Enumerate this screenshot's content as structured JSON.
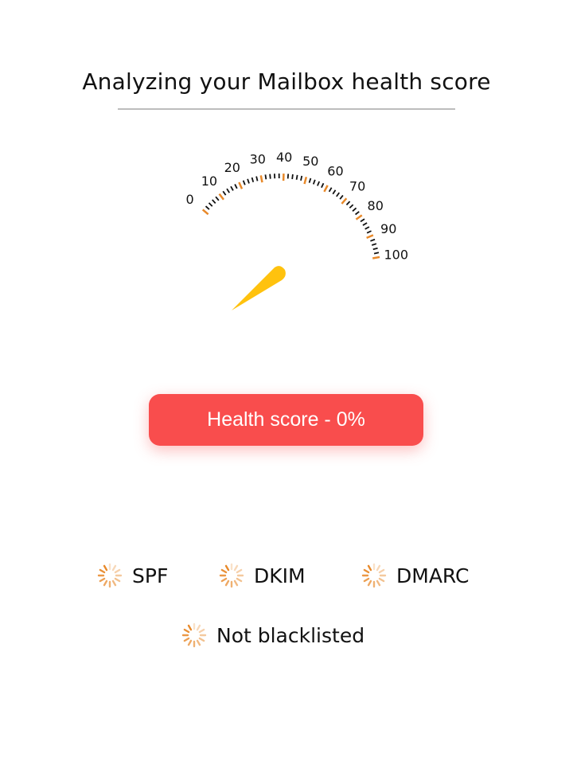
{
  "header": {
    "title": "Analyzing your Mailbox health score"
  },
  "gauge": {
    "min": 0,
    "max": 100,
    "value": 0,
    "tick_labels": [
      "0",
      "10",
      "20",
      "30",
      "40",
      "50",
      "60",
      "70",
      "80",
      "90",
      "100"
    ],
    "major_tick_color": "#e8892a",
    "minor_tick_color": "#111111",
    "needle_color": "#ffc20e"
  },
  "score_button": {
    "label": "Health score - 0%",
    "color": "#f94d4d"
  },
  "checks": {
    "spf": {
      "label": "SPF",
      "icon": "loading-spinner-icon"
    },
    "dkim": {
      "label": "DKIM",
      "icon": "loading-spinner-icon"
    },
    "dmarc": {
      "label": "DMARC",
      "icon": "loading-spinner-icon"
    },
    "blacklist": {
      "label": "Not blacklisted",
      "icon": "loading-spinner-icon"
    }
  },
  "colors": {
    "accent_orange": "#e8892a",
    "button_red": "#f94d4d",
    "needle_yellow": "#ffc20e"
  }
}
